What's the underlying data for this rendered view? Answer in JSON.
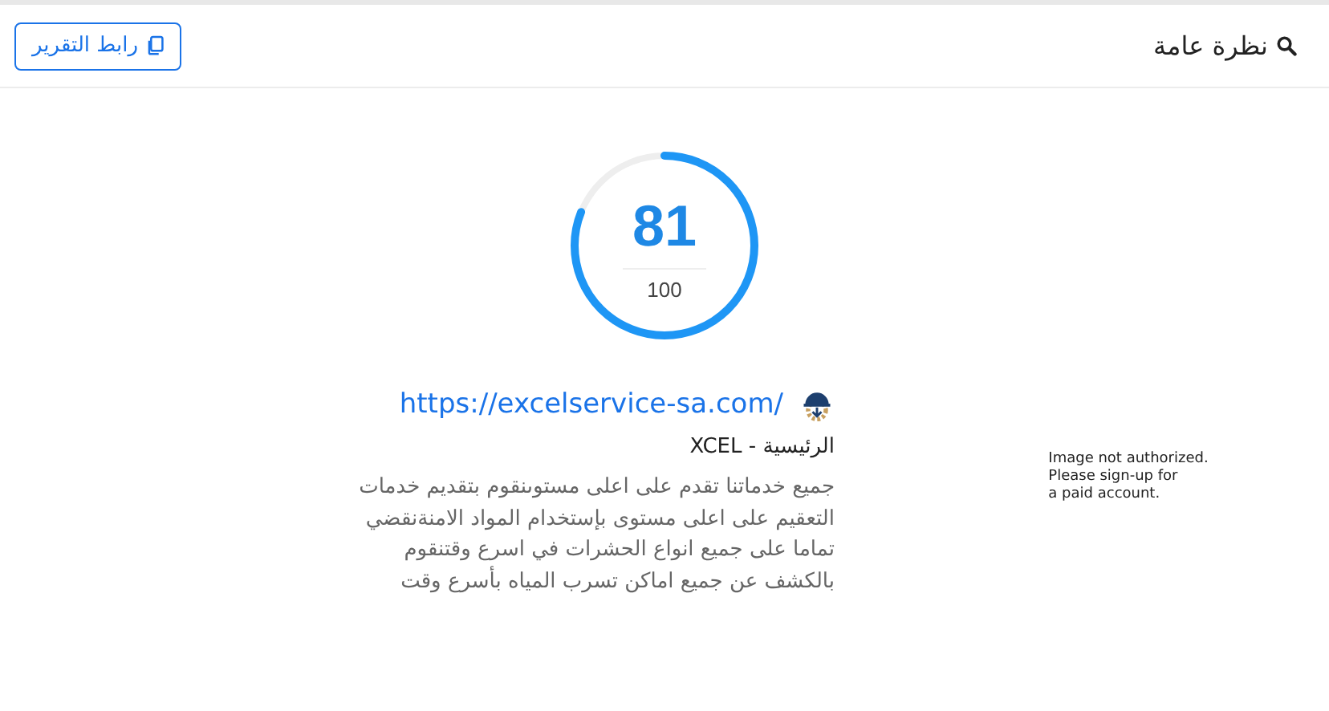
{
  "header": {
    "title": "نظرة عامة",
    "report_link_button": "رابط التقرير"
  },
  "score": {
    "value": "81",
    "max": "100"
  },
  "site": {
    "url": "https://excelservice-sa.com/",
    "page_title": "الرئيسية - XCEL",
    "description": "جميع خدماتنا تقدم على اعلى مستوىنقوم بتقديم خدمات التعقيم على اعلى مستوى بإستخدام المواد الامنةنقضي تماما على جميع انواع الحشرات في اسرع وقتنقوم بالكشف عن جميع اماكن تسرب المياه بأسرع وقت"
  },
  "image_placeholder": {
    "lines": [
      "Image not authorized.",
      "Please sign-up for",
      "a paid account."
    ]
  }
}
